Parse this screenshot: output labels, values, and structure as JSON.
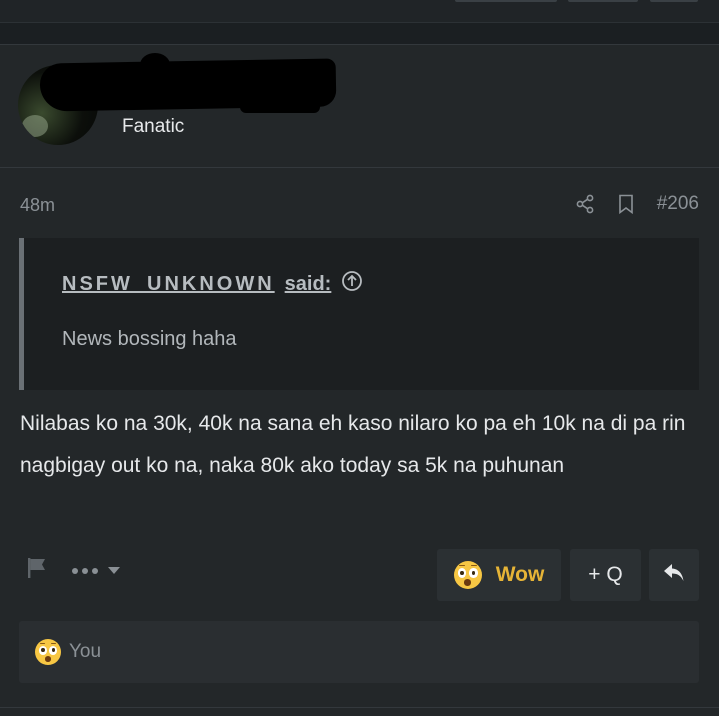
{
  "user": {
    "title": "Fanatic"
  },
  "post": {
    "time": "48m",
    "number": "#206"
  },
  "quote": {
    "author": "NSFW_UNKNOWN",
    "said_label": "said:",
    "body": "News bossing haha"
  },
  "message": {
    "text": "Nilabas ko na 30k, 40k na sana eh kaso nilaro ko pa eh 10k na di pa rin nagbigay out ko na, naka 80k ako today sa 5k na puhunan"
  },
  "actions": {
    "reaction_label": "Wow",
    "quote_label": "+ Q",
    "icons": [
      "flag-icon",
      "more-icon",
      "share-icon",
      "bookmark-icon",
      "reply-icon",
      "expand-quote-icon",
      "wow-emoji-icon"
    ]
  },
  "reactions": {
    "by_label": "You"
  },
  "colors": {
    "background": "#1b1f22",
    "panel": "#232729",
    "quote_bg": "#1c1f21",
    "accent_wow": "#e6b437"
  }
}
